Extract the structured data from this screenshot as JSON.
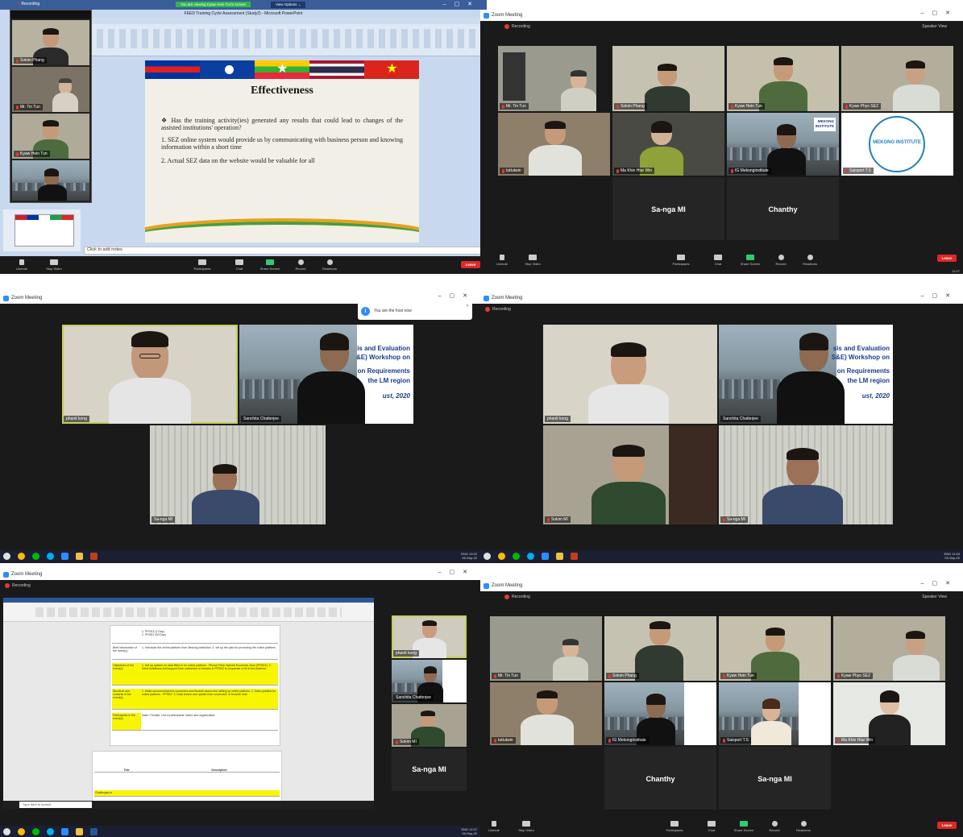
{
  "panel1": {
    "app_title": "FEED Training Cycle Assessment (Study2) - Microsoft PowerPoint",
    "sharing_banner": "You are viewing Kyaw Hein Tun's screen",
    "view_options": "View Options",
    "recording": "Recording",
    "slide": {
      "title": "Effectiveness",
      "bullet": "Has the training activity(ies) generated any results that could lead to changes of the assisted institutions' operation?",
      "point1": "1. SEZ online system would provide us by communicating with business person and knowing information within a short time",
      "point2": "2. Actual SEZ data on the website would be valuable for all"
    },
    "notes_placeholder": "Click to add notes",
    "float_tiles": [
      "Sokim Phang",
      "Mr. Tin Tun",
      "Kyaw Hein Tun",
      ""
    ],
    "controls": {
      "unmute": "Unmute",
      "stop_video": "Stop Video",
      "participants": "Participants",
      "participants_count": "11",
      "chat": "Chat",
      "share": "Share Screen",
      "record": "Record",
      "reactions": "Reactions",
      "leave": "Leave"
    }
  },
  "panel2": {
    "window_title": "Zoom Meeting",
    "recording": "Recording",
    "speaker_view": "Speaker View",
    "tiles": [
      "Mr. Tin Tun",
      "Sokim Phang",
      "Kyaw Hein Tun",
      "Kyaw Phyo SEZ",
      "tuttutwin",
      "Ma Khin Htar Win",
      "IG Mekonginstitute",
      "Saisport T.S"
    ],
    "logo_text": "MEKONG INSTITUTE",
    "name_only": [
      "Sa-nga MI",
      "Chanthy"
    ],
    "controls": {
      "unmute": "Unmute",
      "stop_video": "Stop Video",
      "participants": "Participants",
      "participants_count": "10",
      "chat": "Chat",
      "share": "Share Screen",
      "record": "Record",
      "reactions": "Reactions",
      "leave": "Leave"
    },
    "clock_time": "11:07"
  },
  "panel3": {
    "window_title": "Zoom Meeting",
    "notification": "You are the host now",
    "tiles": [
      "phanit kong",
      "Sanchita Chatterjee",
      "Sa-nga MI"
    ],
    "banner_lines": [
      "is and Evaluation",
      "&E) Workshop on",
      "",
      "on Requirements",
      "the LM region",
      "",
      "ust, 2020"
    ],
    "clock_time": "12:02",
    "clock_date": "03-Sep-20",
    "lang": "ENG"
  },
  "panel4": {
    "window_title": "Zoom Meeting",
    "recording": "Recording",
    "tiles": [
      "phanit kong",
      "Sanchita Chatterjee",
      "Sokim MI",
      "Sa-nga MI"
    ],
    "banner_lines": [
      "sis and Evaluation",
      "S&E) Workshop on",
      "",
      "on Requirements",
      "the LM region",
      "",
      "ust, 2020"
    ],
    "clock_time": "11:53",
    "clock_date": "03-Sep-20",
    "lang": "ENG"
  },
  "panel5": {
    "window_title": "Zoom Meeting",
    "recording": "Recording",
    "doc_rows": [
      {
        "label": "Brief introduction of the event(s)",
        "text": "1. Introduce the online platform from Mekong Institution. 2. set up the plan for promoting the online platform."
      },
      {
        "label": "Objectives of the event(s)",
        "text": "1. Set up system on data fitted in for online platform - Phnom Penh Special Economic Zone (PPSEZ). 2. Send invitations and support from customers or tenants in PPSEZ to cooperate or fill in the platform."
      },
      {
        "label": "Structure and contents of the event(s)",
        "text": "1. Make announcement to customers and tenants about new setting up online platform. 2. Data updated for online platform - PPSEZ. 3. Data review and update from customers' or tenants' side."
      },
      {
        "label": "Participants in the event(s)",
        "text": "Male / Female. List of participants' sector and organization:"
      }
    ],
    "table_header": [
      "Title",
      "Description"
    ],
    "challenges_label": "Challenges in",
    "side_tiles": [
      "phanit kong",
      "Sanchita Chatterjee",
      "Sokim MI"
    ],
    "name_only": "Sa-nga MI",
    "search_placeholder": "Type here to search",
    "clock_time": "11:07",
    "clock_date": "03-Sep-20",
    "lang": "ENG"
  },
  "panel6": {
    "window_title": "Zoom Meeting",
    "recording": "Recording",
    "speaker_view": "Speaker View",
    "tiles": [
      "Mr. Tin Tun",
      "Sokim Phang",
      "Kyaw Hein Tun",
      "Kyaw Phyo SEZ",
      "tuttutwin",
      "IG Mekonginstitute",
      "Saisport T.S",
      "Ma Khin Htar Win"
    ],
    "name_only": [
      "Chanthy",
      "Sa-nga MI"
    ],
    "controls": {
      "unmute": "Unmute",
      "stop_video": "Stop Video",
      "participants": "Participants",
      "participants_count": "10",
      "chat": "Chat",
      "share": "Share Screen",
      "record": "Record",
      "reactions": "Reactions",
      "leave": "Leave"
    }
  },
  "colors": {
    "zoom_blue": "#2d8cff",
    "leave_red": "#e02828",
    "active_speaker": "#c6cf5a",
    "share_green": "#2ecc71"
  }
}
